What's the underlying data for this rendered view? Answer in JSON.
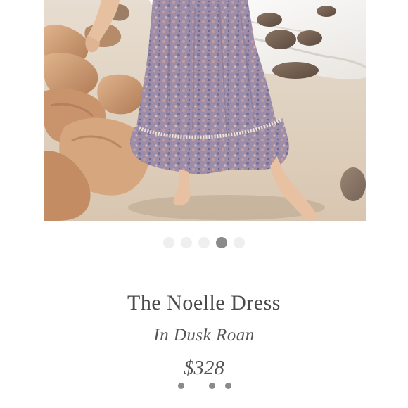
{
  "product": {
    "image_alt": "Model walking barefoot on a rocky beach wearing a floral maxi dress",
    "title": "The Noelle Dress",
    "subtitle": "In Dusk Roan",
    "price": "$328"
  },
  "carousel": {
    "total": 5,
    "active_index": 3
  },
  "colors": {
    "text": "#4a4a4a",
    "dot_inactive": "#efefef",
    "dot_active": "#8a8a8a"
  }
}
